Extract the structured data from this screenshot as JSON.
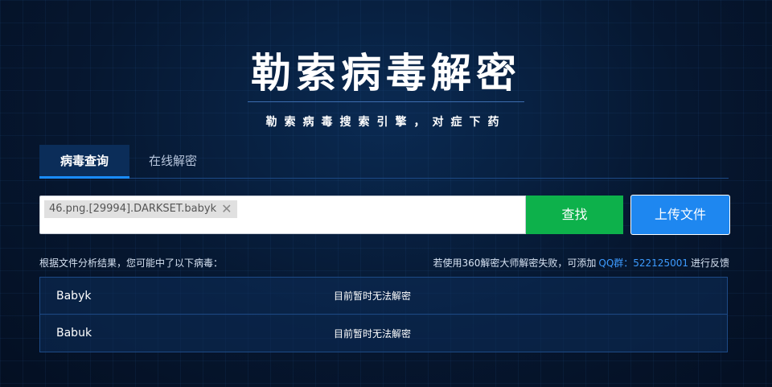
{
  "hero": {
    "title": "勒索病毒解密",
    "subtitle": "勒索病毒搜索引擎，对症下药"
  },
  "tabs": [
    {
      "label": "病毒查询",
      "active": true
    },
    {
      "label": "在线解密",
      "active": false
    }
  ],
  "search": {
    "file_chip": "46.png.[29994].DARKSET.babyk",
    "chip_close_icon": "close-icon",
    "search_button": "查找",
    "upload_button": "上传文件"
  },
  "results": {
    "intro": "根据文件分析结果，您可能中了以下病毒：",
    "hint_prefix": "若使用360解密大师解密失败，可添加",
    "qq": "QQ群：522125001",
    "hint_suffix": "进行反馈",
    "rows": [
      {
        "name": "Babyk",
        "status": "目前暂时无法解密"
      },
      {
        "name": "Babuk",
        "status": "目前暂时无法解密"
      }
    ]
  },
  "colors": {
    "background": "#071a33",
    "search_button": "#0db14b",
    "upload_button": "#1e87f0",
    "accent_link": "#3d9bff"
  }
}
